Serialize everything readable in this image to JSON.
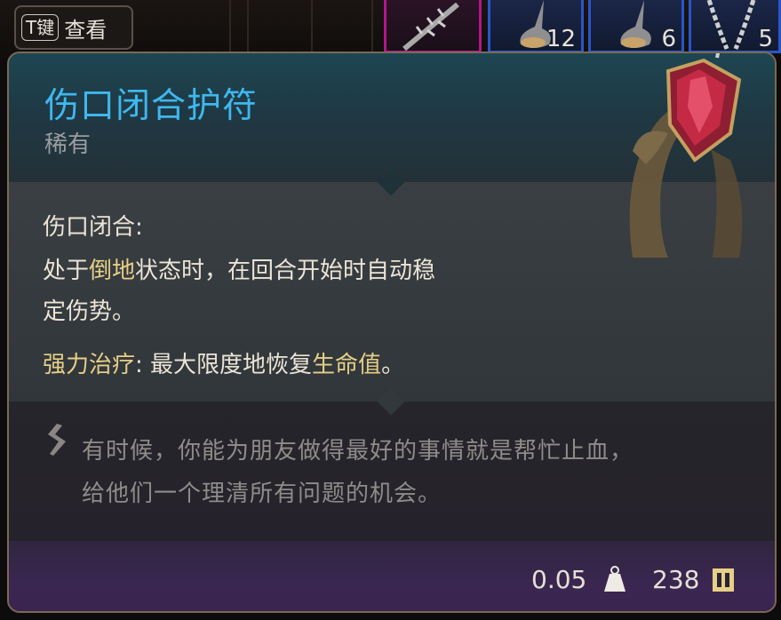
{
  "hint": {
    "key": "T键",
    "label": "查看"
  },
  "inventory": [
    {
      "id": "slot-weapon",
      "count": ""
    },
    {
      "id": "slot-potion-1",
      "count": "12"
    },
    {
      "id": "slot-potion-2",
      "count": "6"
    },
    {
      "id": "slot-amulet",
      "count": "5"
    }
  ],
  "item": {
    "name": "伤口闭合护符",
    "rarity": "稀有",
    "ability1_name": "伤口闭合:",
    "ability1_line1_a": "处于",
    "ability1_line1_keyword": "倒地",
    "ability1_line1_b": "状态时，在回合开始时自动稳",
    "ability1_line2": "定伤势。",
    "ability2_name": "强力治疗",
    "ability2_sep": ": 最大限度地恢复",
    "ability2_keyword": "生命值",
    "ability2_end": "。",
    "flavor_line1": "有时候，你能为朋友做得最好的事情就是帮忙止血，",
    "flavor_line2": "给他们一个理清所有问题的机会。",
    "weight": "0.05",
    "value": "238",
    "icons": [
      "flavor-quill-icon",
      "weight-icon",
      "gold-coin-icon"
    ]
  },
  "colors": {
    "title": "#3fb7ee",
    "keyword": "#e6cf86",
    "rarity": "#9a9ea0",
    "border": "#7a6a55"
  }
}
